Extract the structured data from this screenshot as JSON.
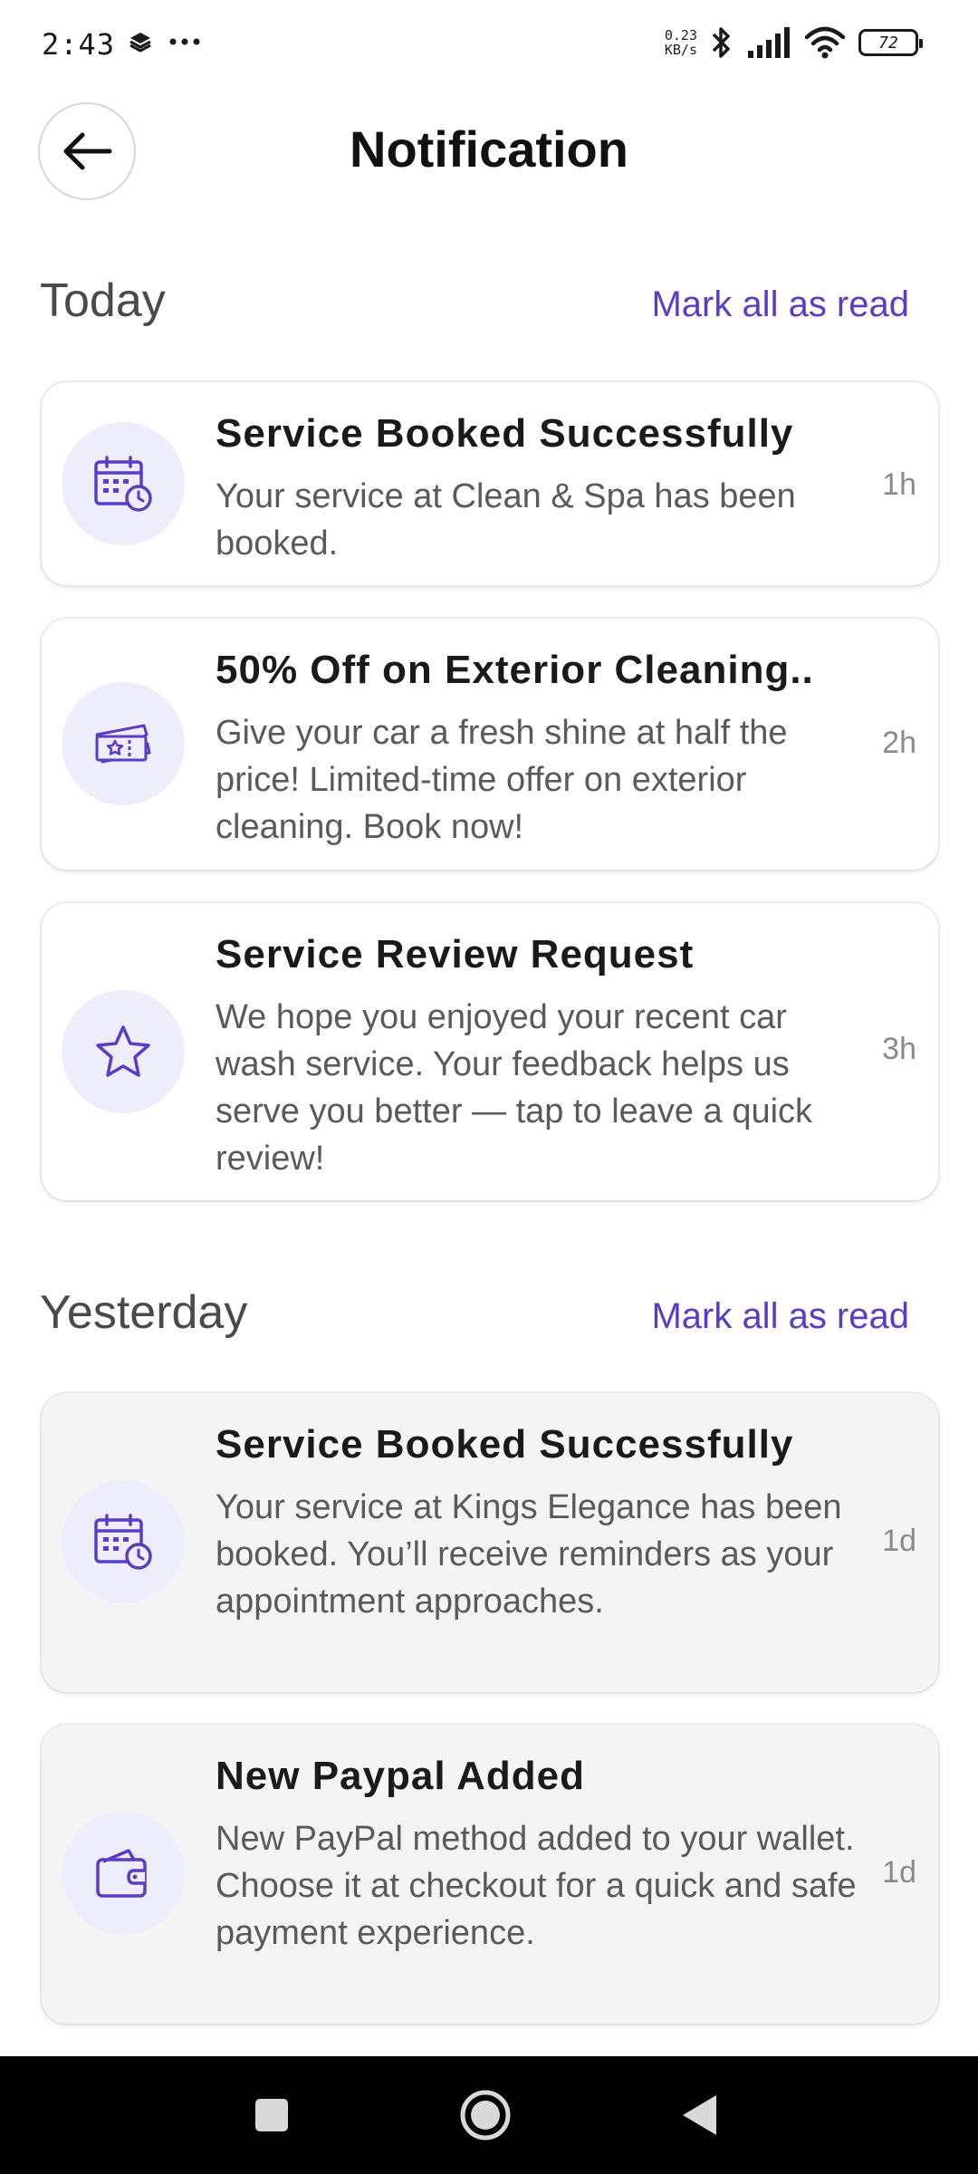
{
  "status_bar": {
    "time": "2:43",
    "net_speed_value": "0.23",
    "net_speed_unit": "KB/s",
    "battery": "72"
  },
  "header": {
    "title": "Notification"
  },
  "sections": [
    {
      "title": "Today",
      "mark_all_label": "Mark all as read",
      "notifications": [
        {
          "icon": "calendar-clock-icon",
          "title": "Service Booked Successfully",
          "body": "Your service at Clean & Spa has been booked.",
          "time": "1h",
          "read": false
        },
        {
          "icon": "ticket-icon",
          "title": "50% Off on Exterior Cleaning..",
          "body": "Give your car a fresh shine at half the price! Limited-time offer on exterior cleaning. Book now!",
          "time": "2h",
          "read": false
        },
        {
          "icon": "star-icon",
          "title": "Service Review Request",
          "body": "We hope you enjoyed your recent car wash service. Your feedback helps us serve you better — tap to leave a quick review!",
          "time": "3h",
          "read": false
        }
      ]
    },
    {
      "title": "Yesterday",
      "mark_all_label": "Mark all as read",
      "notifications": [
        {
          "icon": "calendar-clock-icon",
          "title": "Service Booked Successfully",
          "body": "Your service at Kings Elegance has been booked. You’ll receive reminders as your appointment approaches.",
          "time": "1d",
          "read": true
        },
        {
          "icon": "wallet-icon",
          "title": "New Paypal Added",
          "body": "New PayPal method added to your wallet. Choose it at checkout for a quick and safe payment experience.",
          "time": "1d",
          "read": true
        }
      ]
    }
  ],
  "colors": {
    "accent": "#5b3cc4",
    "icon_bg": "#eeedfc",
    "read_card_bg": "#f4f4f5"
  }
}
